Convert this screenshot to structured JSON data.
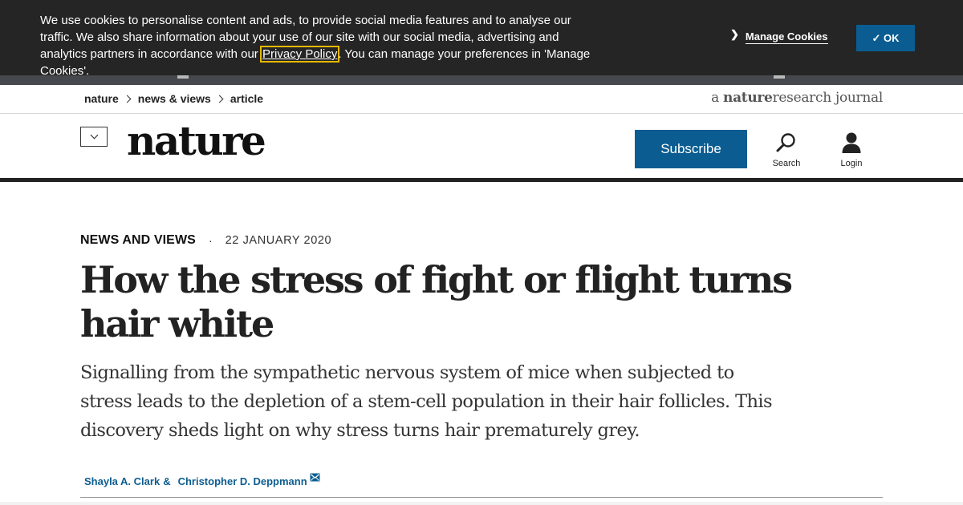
{
  "cookie_banner": {
    "text_before_link": "We use cookies to personalise content and ads, to provide social media features and to analyse our traffic. We also share information about your use of our site with our social media, advertising and analytics partners in accordance with our",
    "privacy_link": "Privacy Policy",
    "text_after_link": ". You can manage your preferences in 'Manage Cookies'.",
    "manage_label": "Manage Cookies",
    "ok_label": "✓ OK"
  },
  "breadcrumb": {
    "items": [
      "nature",
      "news & views",
      "article"
    ]
  },
  "journal_tag": {
    "prefix": "a ",
    "brand": "nature",
    "middle": "research",
    "suffix": " journal"
  },
  "header": {
    "logo": "nature",
    "subscribe_label": "Subscribe",
    "search_label": "Search",
    "login_label": "Login"
  },
  "article": {
    "type": "NEWS AND VIEWS",
    "separator": "·",
    "date": "22 JANUARY 2020",
    "title": "How the stress of fight or flight turns hair white",
    "standfirst": "Signalling from the sympathetic nervous system of mice when subjected to stress leads to the depletion of a stem-cell population in their hair follicles. This discovery sheds light on why stress turns hair prematurely grey.",
    "authors": [
      "Shayla A. Clark",
      "Christopher D. Deppmann"
    ],
    "author_joiner": "&"
  },
  "colors": {
    "banner_bg": "#252525",
    "accent_blue": "#0b5d91",
    "link_focus": "#e6b800"
  },
  "icons": [
    "chevron-down-icon",
    "search-icon",
    "user-icon",
    "mail-icon",
    "chevron-right-icon"
  ]
}
